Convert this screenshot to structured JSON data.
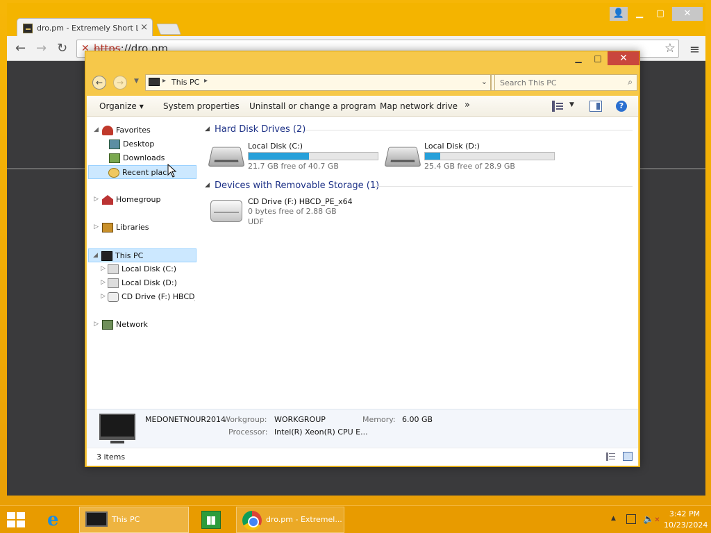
{
  "chrome": {
    "tab_title": "dro.pm - Extremely Short Li",
    "tab_close": "×",
    "url_scheme": "https",
    "url_rest": "://dro.pm",
    "back_icon": "back-arrow-icon",
    "forward_icon": "forward-arrow-icon",
    "reload_icon": "reload-icon",
    "bookmark_icon": "star-icon",
    "menu_icon": "hamburger-icon"
  },
  "explorer": {
    "title_buttons": {
      "minimize": "▁",
      "maximize": "□",
      "close": "✕"
    },
    "breadcrumb": "This PC",
    "search_placeholder": "Search This PC",
    "commands": {
      "organize": "Organize",
      "system_properties": "System properties",
      "uninstall": "Uninstall or change a program",
      "map_drive": "Map network drive",
      "more": "»"
    },
    "nav": {
      "favorites": "Favorites",
      "desktop": "Desktop",
      "downloads": "Downloads",
      "recent_places": "Recent plac",
      "homegroup": "Homegroup",
      "libraries": "Libraries",
      "this_pc": "This PC",
      "local_c": "Local Disk (C:)",
      "local_d": "Local Disk (D:)",
      "cd_drive": "CD Drive (F:) HBCD_F",
      "network": "Network"
    },
    "groups": {
      "hard_disks": "Hard Disk Drives (2)",
      "removable": "Devices with Removable Storage (1)"
    },
    "drives": [
      {
        "name": "Local Disk (C:)",
        "free_text": "21.7 GB free of 40.7 GB",
        "used_fraction": 0.47
      },
      {
        "name": "Local Disk (D:)",
        "free_text": "25.4 GB free of 28.9 GB",
        "used_fraction": 0.12
      }
    ],
    "cd": {
      "name": "CD Drive (F:) HBCD_PE_x64",
      "free_text": "0 bytes free of 2.88 GB",
      "filesystem": "UDF"
    },
    "details": {
      "computer_name": "MEDONETNOUR2014",
      "workgroup_label": "Workgroup:",
      "workgroup_value": "WORKGROUP",
      "memory_label": "Memory:",
      "memory_value": "6.00 GB",
      "processor_label": "Processor:",
      "processor_value": "Intel(R) Xeon(R) CPU E..."
    },
    "status": {
      "item_count": "3 items"
    }
  },
  "taskbar": {
    "this_pc_label": "This PC",
    "chrome_label": "dro.pm - Extremel...",
    "clock_time": "3:42 PM",
    "clock_date": "10/23/2024"
  },
  "colors": {
    "desktop_accent": "#f4b400",
    "explorer_frame": "#f6c84a",
    "drive_bar_fill": "#26a0da",
    "group_header_text": "#1e3287",
    "close_button": "#c9463d"
  }
}
